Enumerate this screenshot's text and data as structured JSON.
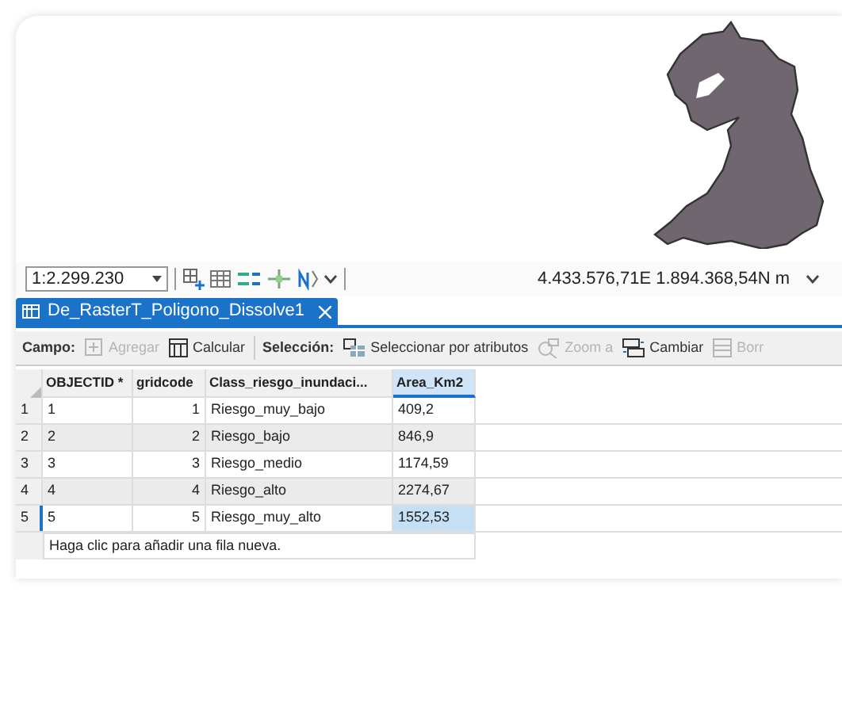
{
  "map": {
    "scale": "1:2.299.230",
    "coordinates": "4.433.576,71E 1.894.368,54N m"
  },
  "tab": {
    "title": "De_RasterT_Poligono_Dissolve1",
    "selected": true
  },
  "toolbar": {
    "field_label": "Campo:",
    "field_buttons": [
      {
        "label": "Agregar",
        "disabled": true
      },
      {
        "label": "Calcular",
        "disabled": false
      }
    ],
    "selection_label": "Selección:",
    "selection_buttons": [
      {
        "label": "Seleccionar por atributos",
        "disabled": false
      },
      {
        "label": "Zoom a",
        "disabled": true
      },
      {
        "label": "Cambiar",
        "disabled": false
      },
      {
        "label": "Borr",
        "disabled": true
      }
    ]
  },
  "table": {
    "columns": [
      {
        "label": "OBJECTID *",
        "selected": false
      },
      {
        "label": "gridcode",
        "selected": false
      },
      {
        "label": "Class_riesgo_inundaci...",
        "selected": false
      },
      {
        "label": "Area_Km2",
        "selected": true
      }
    ],
    "rows": [
      {
        "number": "1",
        "cells": [
          "1",
          "1",
          "Riesgo_muy_bajo",
          "409,2"
        ],
        "selected": false
      },
      {
        "number": "2",
        "cells": [
          "2",
          "2",
          "Riesgo_bajo",
          "846,9"
        ],
        "selected": false
      },
      {
        "number": "3",
        "cells": [
          "3",
          "3",
          "Riesgo_medio",
          "1174,59"
        ],
        "selected": false
      },
      {
        "number": "4",
        "cells": [
          "4",
          "4",
          "Riesgo_alto",
          "2274,67"
        ],
        "selected": false
      },
      {
        "number": "5",
        "cells": [
          "5",
          "5",
          "Riesgo_muy_alto",
          "1552,53"
        ],
        "selected": true
      }
    ],
    "new_row_hint": "Haga clic para añadir una fila nueva."
  }
}
